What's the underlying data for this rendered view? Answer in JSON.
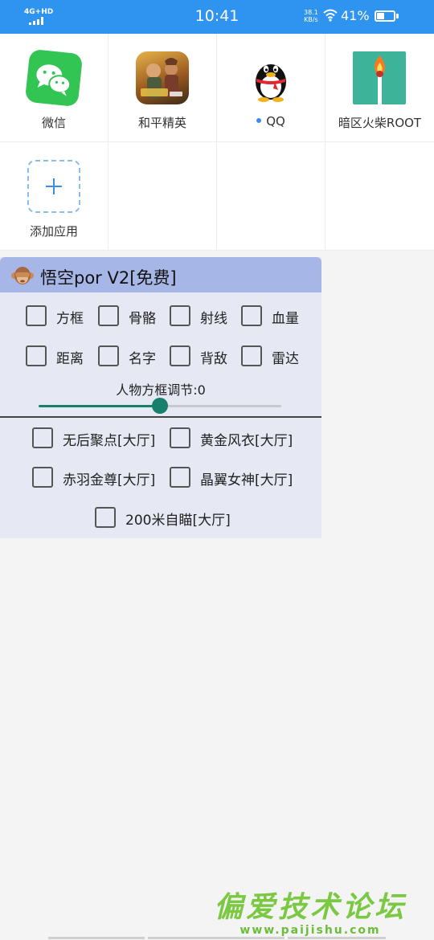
{
  "status_bar": {
    "network": "4G+HD",
    "time": "10:41",
    "speed_value": "38.1",
    "speed_unit": "KB/s",
    "battery": "41%"
  },
  "apps": [
    {
      "label": "微信",
      "icon": "wechat-icon"
    },
    {
      "label": "和平精英",
      "icon": "peace-elite-icon"
    },
    {
      "label": "QQ",
      "icon": "qq-penguin-icon"
    },
    {
      "label": "暗区火柴ROOT",
      "icon": "match-icon"
    },
    {
      "label": "添加应用",
      "icon": "add-icon"
    }
  ],
  "panel": {
    "title": "悟空por V2[免费]",
    "options_row1": [
      "方框",
      "骨骼",
      "射线",
      "血量"
    ],
    "options_row2": [
      "距离",
      "名字",
      "背敌",
      "雷达"
    ],
    "slider_label": "人物方框调节:0",
    "slider_fraction": 0.5,
    "lobby_options": [
      "无后聚点[大厅]",
      "黄金风衣[大厅]",
      "赤羽金尊[大厅]",
      "晶翼女神[大厅]",
      "200米自瞄[大厅]"
    ]
  },
  "watermark": {
    "title": "偏爱技术论坛",
    "url": "www.paijishu.com"
  },
  "colors": {
    "status_bar": "#2f93f0",
    "panel_header": "#a6b6e6",
    "panel_body": "#e6e8f3",
    "slider_accent": "#16806d"
  }
}
